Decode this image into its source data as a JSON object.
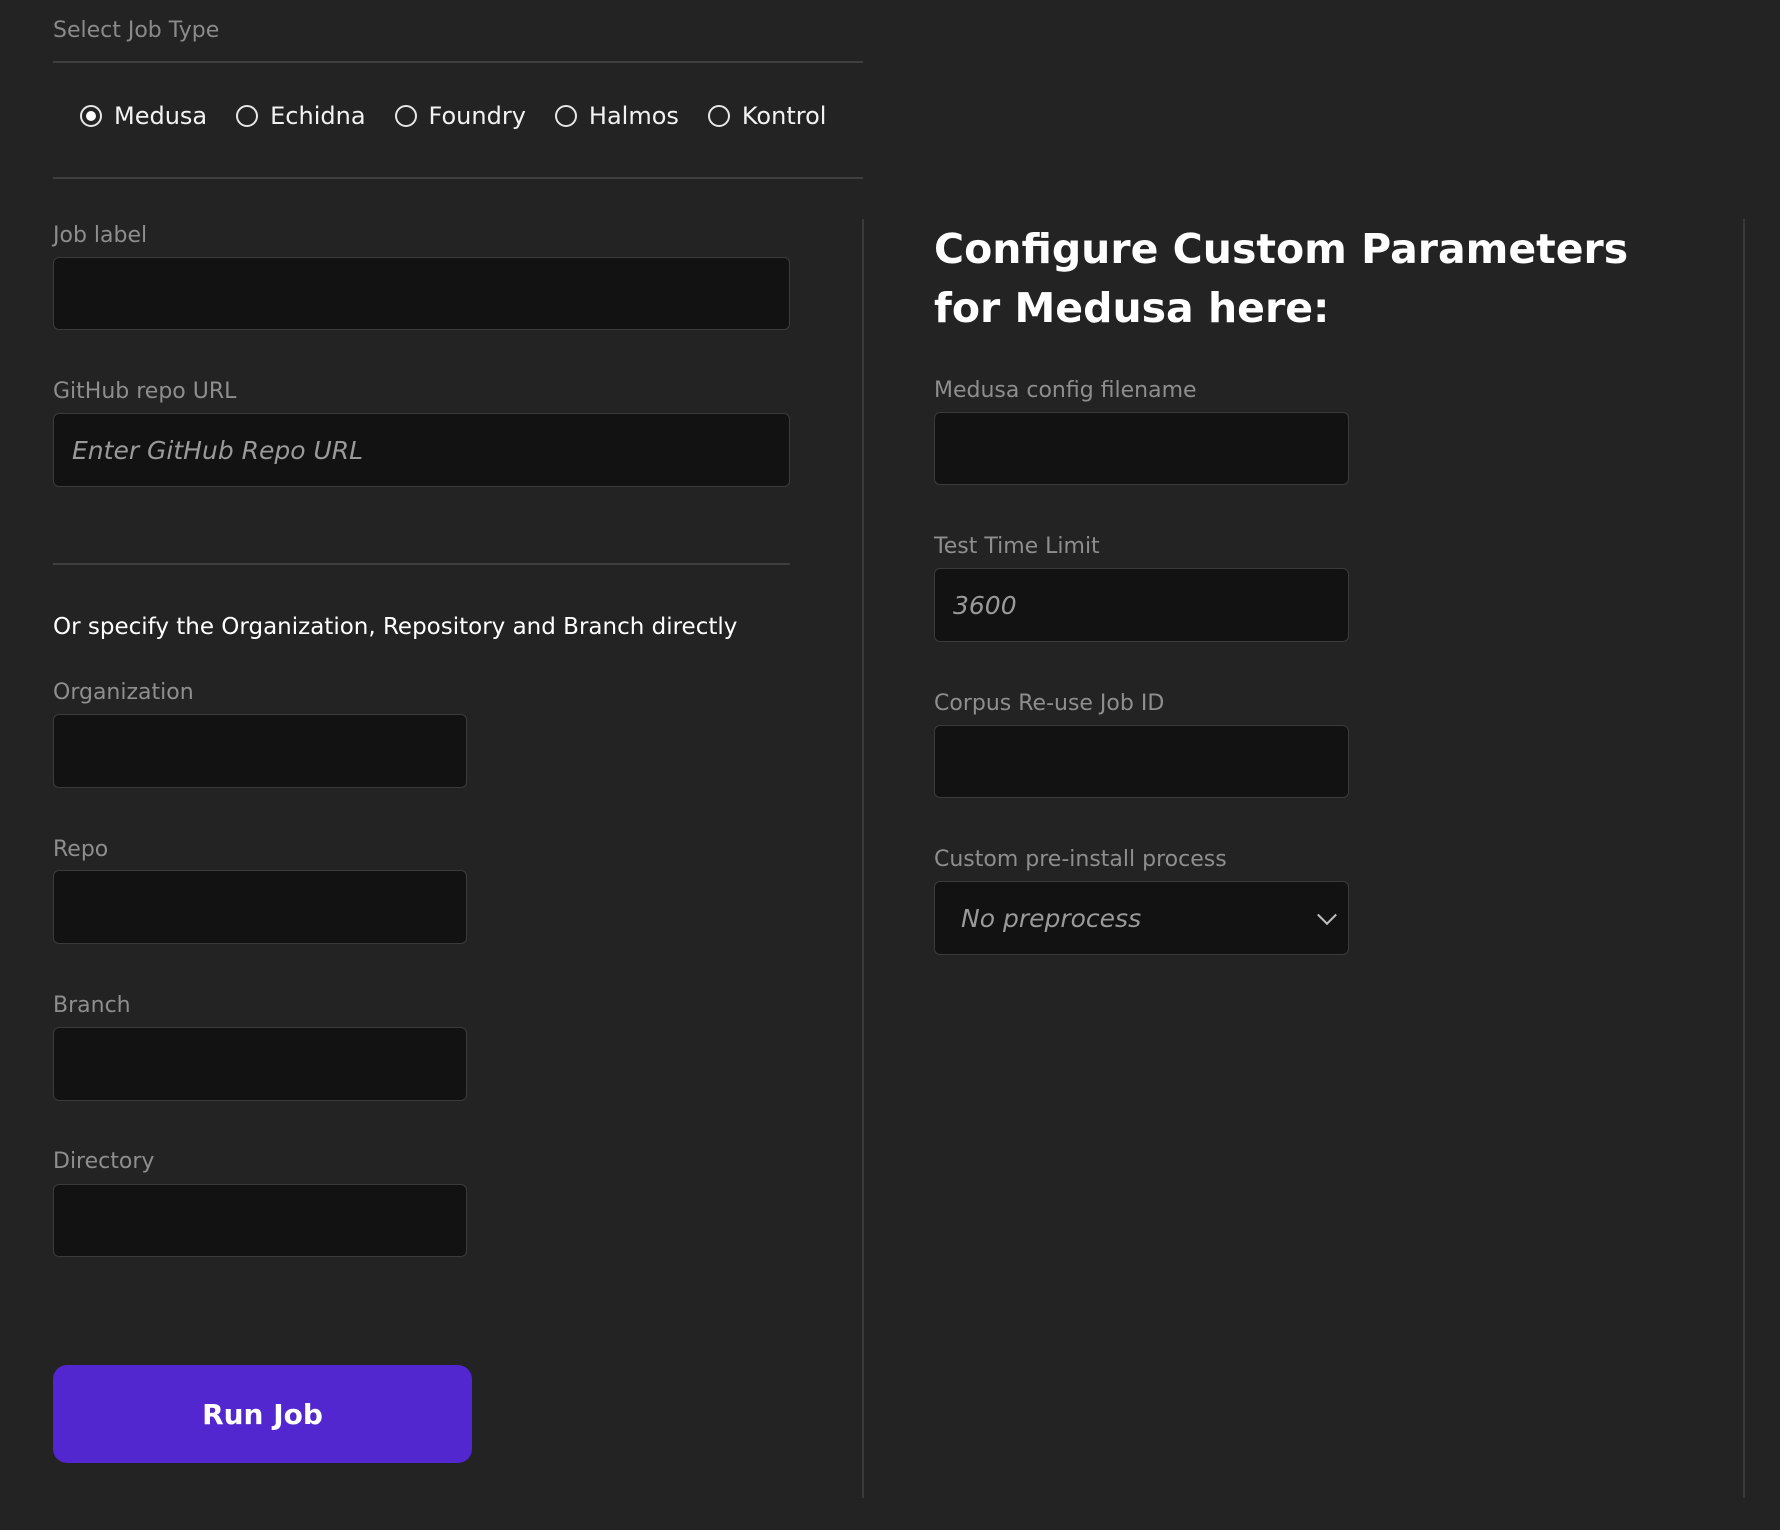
{
  "job_type": {
    "label": "Select Job Type",
    "options": [
      {
        "label": "Medusa",
        "checked": true
      },
      {
        "label": "Echidna",
        "checked": false
      },
      {
        "label": "Foundry",
        "checked": false
      },
      {
        "label": "Halmos",
        "checked": false
      },
      {
        "label": "Kontrol",
        "checked": false
      }
    ]
  },
  "left_form": {
    "job_label": {
      "label": "Job label",
      "value": ""
    },
    "github_url": {
      "label": "GitHub repo URL",
      "placeholder": "Enter GitHub Repo URL"
    },
    "direct_heading": "Or specify the Organization, Repository and Branch directly",
    "organization": {
      "label": "Organization",
      "value": ""
    },
    "repo": {
      "label": "Repo",
      "value": ""
    },
    "branch": {
      "label": "Branch",
      "value": ""
    },
    "directory": {
      "label": "Directory",
      "value": ""
    }
  },
  "right_form": {
    "title": "Configure Custom Parameters for Medusa here:",
    "config_filename": {
      "label": "Medusa config filename",
      "value": ""
    },
    "time_limit": {
      "label": "Test Time Limit",
      "placeholder": "3600"
    },
    "corpus_job_id": {
      "label": "Corpus Re-use Job ID",
      "value": ""
    },
    "preinstall": {
      "label": "Custom pre-install process",
      "selected": "No preprocess"
    }
  },
  "actions": {
    "run_label": "Run Job"
  },
  "colors": {
    "background": "#232323",
    "input_bg": "#121212",
    "accent": "#5227cf"
  }
}
